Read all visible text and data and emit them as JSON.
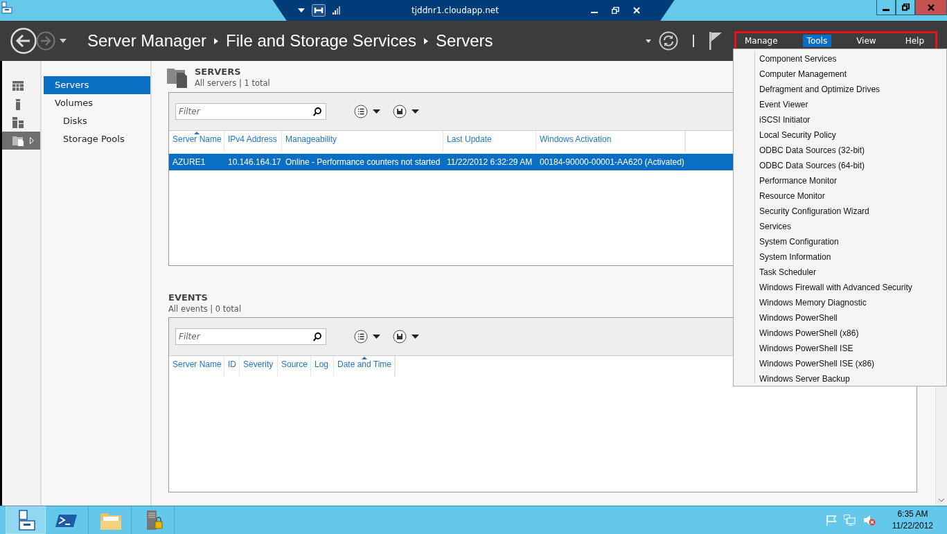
{
  "connection_bar": {
    "title": "tjddnr1.cloudapp.net"
  },
  "header": {
    "breadcrumb": [
      "Server Manager",
      "File and Storage Services",
      "Servers"
    ],
    "menu": [
      {
        "label": "Manage",
        "selected": false
      },
      {
        "label": "Tools",
        "selected": true
      },
      {
        "label": "View",
        "selected": false
      },
      {
        "label": "Help",
        "selected": false
      }
    ]
  },
  "sidebar": {
    "items": [
      {
        "kind": "dashboard",
        "selected": false
      },
      {
        "kind": "local",
        "selected": false
      },
      {
        "kind": "all",
        "selected": false
      },
      {
        "kind": "files",
        "selected": true
      }
    ]
  },
  "nav": {
    "items": [
      {
        "label": "Servers",
        "selected": true
      },
      {
        "label": "Volumes",
        "selected": false,
        "children": [
          {
            "label": "Disks",
            "selected": false
          },
          {
            "label": "Storage Pools",
            "selected": false
          }
        ]
      }
    ]
  },
  "servers": {
    "title": "SERVERS",
    "subtitle": "All servers | 1 total",
    "filter": {
      "placeholder": "Filter"
    },
    "columns": [
      {
        "label": "Server Name",
        "sorted": true
      },
      {
        "label": "IPv4 Address",
        "sorted": false
      },
      {
        "label": "Manageability",
        "sorted": false
      },
      {
        "label": "Last Update",
        "sorted": false
      },
      {
        "label": "Windows Activation",
        "sorted": false
      }
    ],
    "rows": [
      {
        "selected": true,
        "cells": [
          "AZURE1",
          "10.146.164.17",
          "Online - Performance counters not started",
          "11/22/2012 6:32:29 AM",
          "00184-90000-00001-AA620 (Activated)"
        ]
      }
    ]
  },
  "events": {
    "title": "EVENTS",
    "subtitle": "All events | 0 total",
    "filter": {
      "placeholder": "Filter"
    },
    "columns": [
      {
        "label": "Server Name",
        "sorted": false
      },
      {
        "label": "ID",
        "sorted": false
      },
      {
        "label": "Severity",
        "sorted": false
      },
      {
        "label": "Source",
        "sorted": false
      },
      {
        "label": "Log",
        "sorted": false
      },
      {
        "label": "Date and Time",
        "sorted": true
      }
    ]
  },
  "tools_menu": {
    "items": [
      "Component Services",
      "Computer Management",
      "Defragment and Optimize Drives",
      "Event Viewer",
      "iSCSI Initiator",
      "Local Security Policy",
      "ODBC Data Sources (32-bit)",
      "ODBC Data Sources (64-bit)",
      "Performance Monitor",
      "Resource Monitor",
      "Security Configuration Wizard",
      "Services",
      "System Configuration",
      "System Information",
      "Task Scheduler",
      "Windows Firewall with Advanced Security",
      "Windows Memory Diagnostic",
      "Windows PowerShell",
      "Windows PowerShell (x86)",
      "Windows PowerShell ISE",
      "Windows PowerShell ISE (x86)",
      "Windows Server Backup"
    ]
  },
  "taskbar": {
    "apps": [
      {
        "kind": "server-manager",
        "selected": true
      },
      {
        "kind": "powershell",
        "selected": false
      },
      {
        "kind": "explorer",
        "selected": false
      },
      {
        "kind": "tower",
        "selected": false
      }
    ],
    "time": "6:35 AM",
    "date": "11/22/2012"
  }
}
